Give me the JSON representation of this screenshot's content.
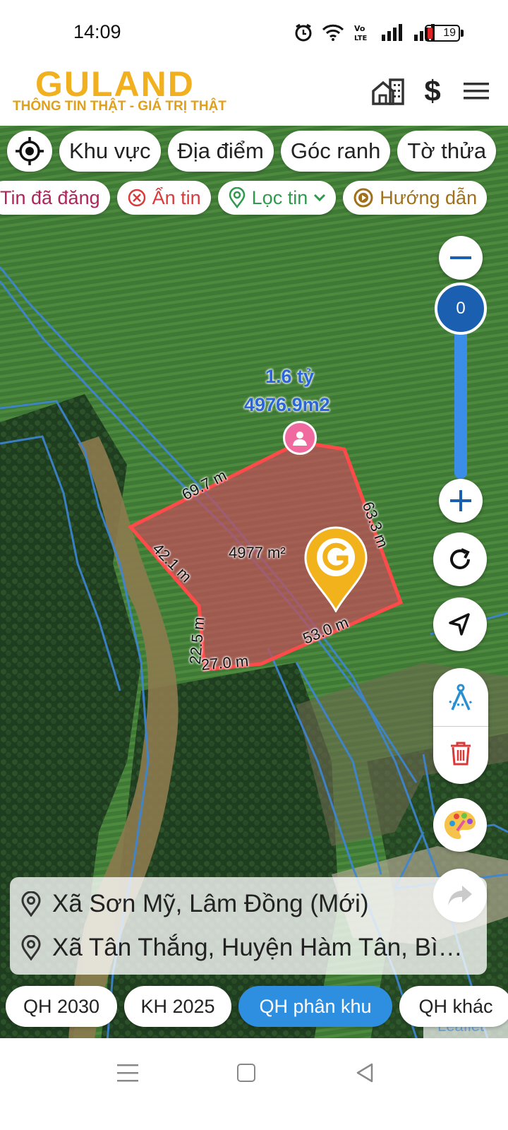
{
  "status_bar": {
    "time": "14:09",
    "battery": "19"
  },
  "header": {
    "logo": "GULAND",
    "tagline": "THÔNG TIN THẬT - GIÁ TRỊ THẬT"
  },
  "filter_chips": [
    "Khu vực",
    "Địa điểm",
    "Góc ranh",
    "Tờ thửa"
  ],
  "action_chips": {
    "posted": "Tin đã đăng",
    "hide": "Ẩn tin",
    "filter": "Lọc tin",
    "guide": "Hướng dẫn"
  },
  "listing": {
    "price": "1.6 tỷ",
    "area": "4976.9m2",
    "area_label": "4977 m²"
  },
  "edges": {
    "top": "69.7 m",
    "right": "63.3 m",
    "left_upper": "42.1 m",
    "left_lower": "22.5 m",
    "bottom_left": "27.0 m",
    "bottom_right": "53.0 m"
  },
  "zoom": {
    "value": "0",
    "level": 0
  },
  "address": {
    "line1": "Xã Sơn Mỹ, Lâm Đồng (Mới)",
    "line2": "Xã Tân Thắng, Huyện Hàm Tân, Bì…"
  },
  "plan_chips": [
    "QH 2030",
    "KH 2025",
    "QH phân khu",
    "QH khác"
  ],
  "leaflet": "Leaflet",
  "colors": {
    "brand": "#f0b020",
    "accent": "#2e8ee0",
    "plot_fill": "#c0505a",
    "plot_stroke": "#ff4a4a",
    "posted": "#b0245a",
    "hide": "#d93a3a",
    "filter": "#2f9a4e",
    "guide": "#a0701a"
  }
}
